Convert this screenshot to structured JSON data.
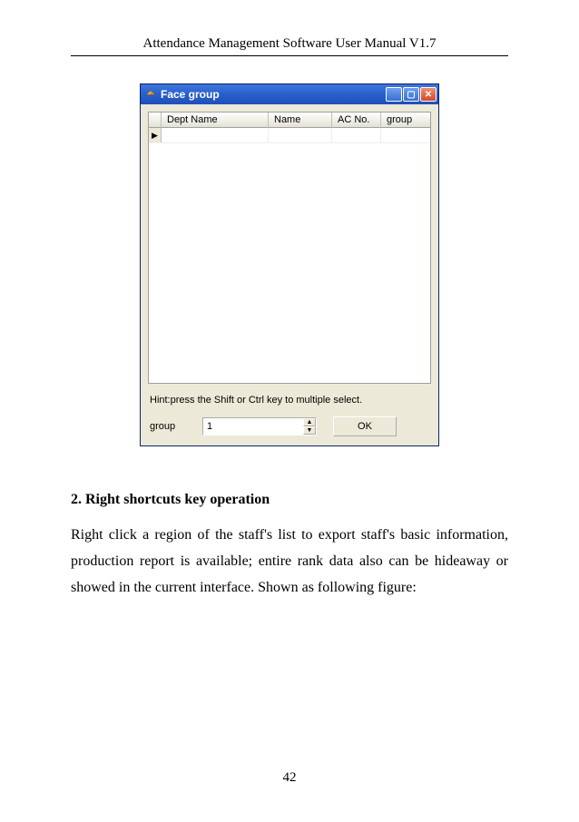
{
  "doc": {
    "header": "Attendance Management Software User Manual V1.7",
    "page_number": "42",
    "section_heading": "2. Right shortcuts key operation",
    "body": "Right click a region of the staff's list to export staff's basic information, production report is available; entire rank data also can be hideaway or showed in the current interface. Shown as following figure:"
  },
  "window": {
    "title": "Face group",
    "columns": {
      "dept": "Dept Name",
      "name": "Name",
      "ac": "AC No.",
      "group": "group"
    },
    "hint": "Hint:press the Shift or Ctrl key to multiple select.",
    "group_label": "group",
    "group_value": "1",
    "ok_label": "OK"
  }
}
